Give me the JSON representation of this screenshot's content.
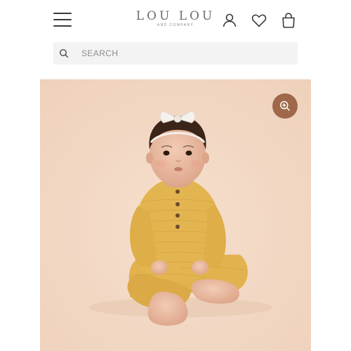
{
  "header": {
    "logo_main": "LOU LOU",
    "logo_sub": "AND COMPANY",
    "icons": [
      "menu-icon",
      "account-icon",
      "heart-icon",
      "bag-icon"
    ]
  },
  "search": {
    "placeholder": "SEARCH",
    "value": ""
  },
  "product": {
    "image": "baby in mustard yellow gauze romper with white bow headband",
    "zoom_icon": "zoom-in-icon"
  },
  "colors": {
    "image_background": "#f2d8c4",
    "zoom_button": "#a0684a",
    "search_background": "#f3f3f3"
  }
}
